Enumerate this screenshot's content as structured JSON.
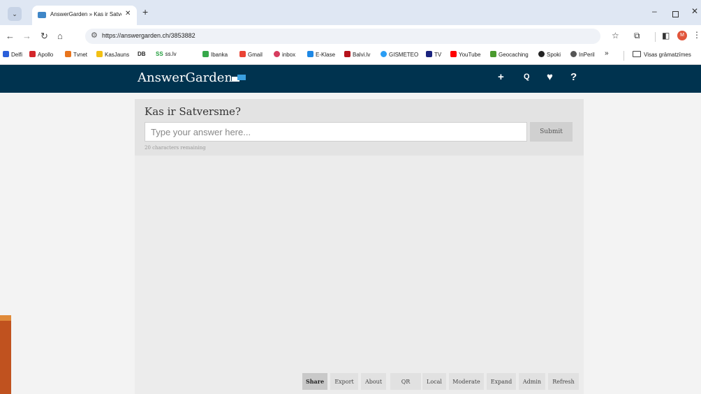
{
  "browser": {
    "tab_title": "AnswerGarden » Kas ir Satversme?",
    "url": "https://answergarden.ch/3853882",
    "new_tab_label": "+",
    "profile_initial": "M",
    "bookmarks": [
      {
        "label": "Delfi",
        "color": "#2b5fd9"
      },
      {
        "label": "Apollo",
        "color": "#d3262b"
      },
      {
        "label": "Tvnet",
        "color": "#e8741c"
      },
      {
        "label": "KasJauns",
        "color": "#f2c014"
      },
      {
        "label": "ss.lv",
        "color": "#1f9d3a"
      },
      {
        "label": "Ibanka",
        "color": "#36a84a"
      },
      {
        "label": "Gmail",
        "color": "#ea4335"
      },
      {
        "label": "inbox",
        "color": "#d63c5e"
      },
      {
        "label": "E-Klase",
        "color": "#1e88e5"
      },
      {
        "label": "Balvi.lv",
        "color": "#b5121b"
      },
      {
        "label": "GISMETEO",
        "color": "#2a9df4"
      },
      {
        "label": "TV",
        "color": "#1a237e"
      },
      {
        "label": "YouTube",
        "color": "#ff0000"
      },
      {
        "label": "Geocaching",
        "color": "#4a9a2e"
      },
      {
        "label": "Spoki",
        "color": "#222222"
      },
      {
        "label": "InPeril",
        "color": "#555555"
      }
    ],
    "db_label": "DB",
    "ss_label": "SS",
    "overflow_label": "»",
    "other_bookmarks": "Visas grāmatzīmes"
  },
  "site": {
    "logo_text": "AnswerGarden",
    "header_icons": [
      "plus-icon",
      "search-icon",
      "heart-icon",
      "question-icon"
    ],
    "header_icon_glyphs": [
      "+",
      "Q",
      "♥",
      "?"
    ]
  },
  "question": {
    "title": "Kas ir Satversme?",
    "placeholder": "Type your answer here...",
    "submit_label": "Submit",
    "remaining": "20 characters remaining"
  },
  "actions": [
    "Share",
    "Export",
    "About",
    "QR",
    "Local",
    "Moderate",
    "Expand",
    "Admin",
    "Refresh"
  ],
  "active_action": "Share",
  "colors": {
    "header_bg": "#00334f",
    "page_bg": "#f3f3f3",
    "card_bg": "#e3e3e3"
  }
}
